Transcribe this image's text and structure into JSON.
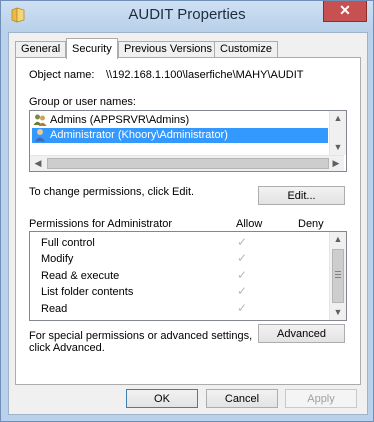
{
  "window": {
    "title": "AUDIT Properties",
    "close_glyph": "✕"
  },
  "tabs": [
    {
      "label": "General"
    },
    {
      "label": "Security"
    },
    {
      "label": "Previous Versions"
    },
    {
      "label": "Customize"
    }
  ],
  "object": {
    "label": "Object name:",
    "value": "\\\\192.168.1.100\\laserfiche\\MAHY\\AUDIT"
  },
  "groups": {
    "label": "Group or user names:",
    "items": [
      {
        "label": "Admins (APPSRVR\\Admins)",
        "icon": "group-icon",
        "selected": false
      },
      {
        "label": "Administrator (Khoory\\Administrator)",
        "icon": "user-icon",
        "selected": true
      }
    ]
  },
  "change": {
    "text": "To change permissions, click Edit.",
    "edit_label": "Edit..."
  },
  "permissions": {
    "header": "Permissions for Administrator",
    "allow_header": "Allow",
    "deny_header": "Deny",
    "rows": [
      {
        "name": "Full control",
        "allow": true,
        "deny": false
      },
      {
        "name": "Modify",
        "allow": true,
        "deny": false
      },
      {
        "name": "Read & execute",
        "allow": true,
        "deny": false
      },
      {
        "name": "List folder contents",
        "allow": true,
        "deny": false
      },
      {
        "name": "Read",
        "allow": true,
        "deny": false
      }
    ]
  },
  "special": {
    "text1": "For special permissions or advanced settings,",
    "text2": "click Advanced.",
    "advanced_label": "Advanced"
  },
  "footer": {
    "ok": "OK",
    "cancel": "Cancel",
    "apply": "Apply"
  },
  "checkmark": "✓"
}
